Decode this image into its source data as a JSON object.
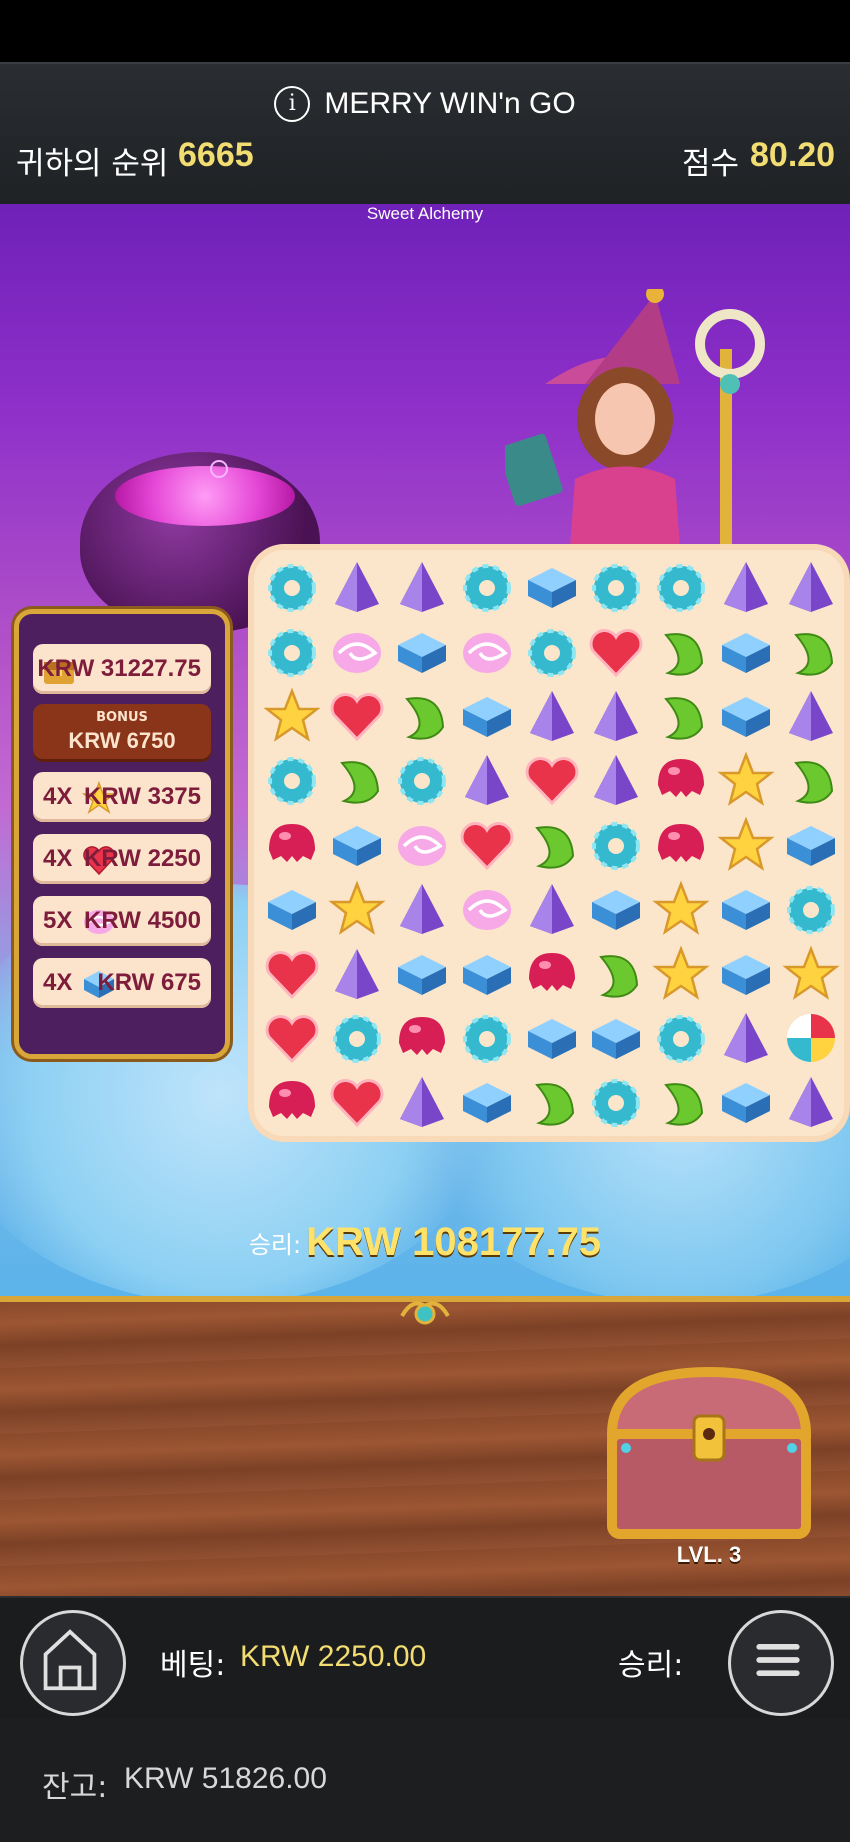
{
  "promo": {
    "title": "MERRY WIN'n GO",
    "rank_label": "귀하의 순위",
    "rank_value": "6665",
    "score_label": "점수",
    "score_value": "80.20"
  },
  "game": {
    "title": "Sweet Alchemy"
  },
  "paytable": {
    "top_value": "KRW 31227.75",
    "bonus_label": "BONUS",
    "bonus_value": "KRW 6750",
    "rows": [
      {
        "mult": "4X",
        "symbol": "star",
        "value": "KRW 3375"
      },
      {
        "mult": "4X",
        "symbol": "heart",
        "value": "KRW 2250"
      },
      {
        "mult": "5X",
        "symbol": "swirl",
        "value": "KRW 4500"
      },
      {
        "mult": "4X",
        "symbol": "cube",
        "value": "KRW 675"
      }
    ]
  },
  "board": {
    "rows": [
      [
        "ring",
        "gem",
        "gem",
        "ring",
        "cube",
        "ring",
        "ring",
        "gem",
        "gem"
      ],
      [
        "ring",
        "swirl",
        "cube",
        "swirl",
        "ring",
        "heart",
        "moon",
        "cube",
        "moon"
      ],
      [
        "star",
        "heart",
        "moon",
        "cube",
        "gem",
        "gem",
        "moon",
        "cube",
        "gem"
      ],
      [
        "ring",
        "moon",
        "ring",
        "gem",
        "heart",
        "gem",
        "jelly",
        "star",
        "moon"
      ],
      [
        "jelly",
        "cube",
        "swirl",
        "heart",
        "moon",
        "ring",
        "jelly",
        "star",
        "cube"
      ],
      [
        "cube",
        "star",
        "gem",
        "swirl",
        "gem",
        "cube",
        "star",
        "cube",
        "ring"
      ],
      [
        "heart",
        "gem",
        "cube",
        "cube",
        "jelly",
        "moon",
        "star",
        "cube",
        "star"
      ],
      [
        "heart",
        "ring",
        "jelly",
        "ring",
        "cube",
        "cube",
        "ring",
        "gem",
        "lollipop"
      ],
      [
        "jelly",
        "heart",
        "gem",
        "cube",
        "moon",
        "ring",
        "moon",
        "cube",
        "gem"
      ]
    ]
  },
  "win": {
    "label": "승리:",
    "value": "KRW 108177.75"
  },
  "chest": {
    "level": "LVL. 3"
  },
  "controls": {
    "bet_label": "베팅:",
    "bet_value": "KRW 2250.00",
    "win_label": "승리:"
  },
  "balance": {
    "label": "잔고:",
    "value": "KRW 51826.00"
  },
  "colors": {
    "gold": "#f2dd72",
    "header_bg": "#24272a",
    "win_gold": "#ffe26a"
  }
}
